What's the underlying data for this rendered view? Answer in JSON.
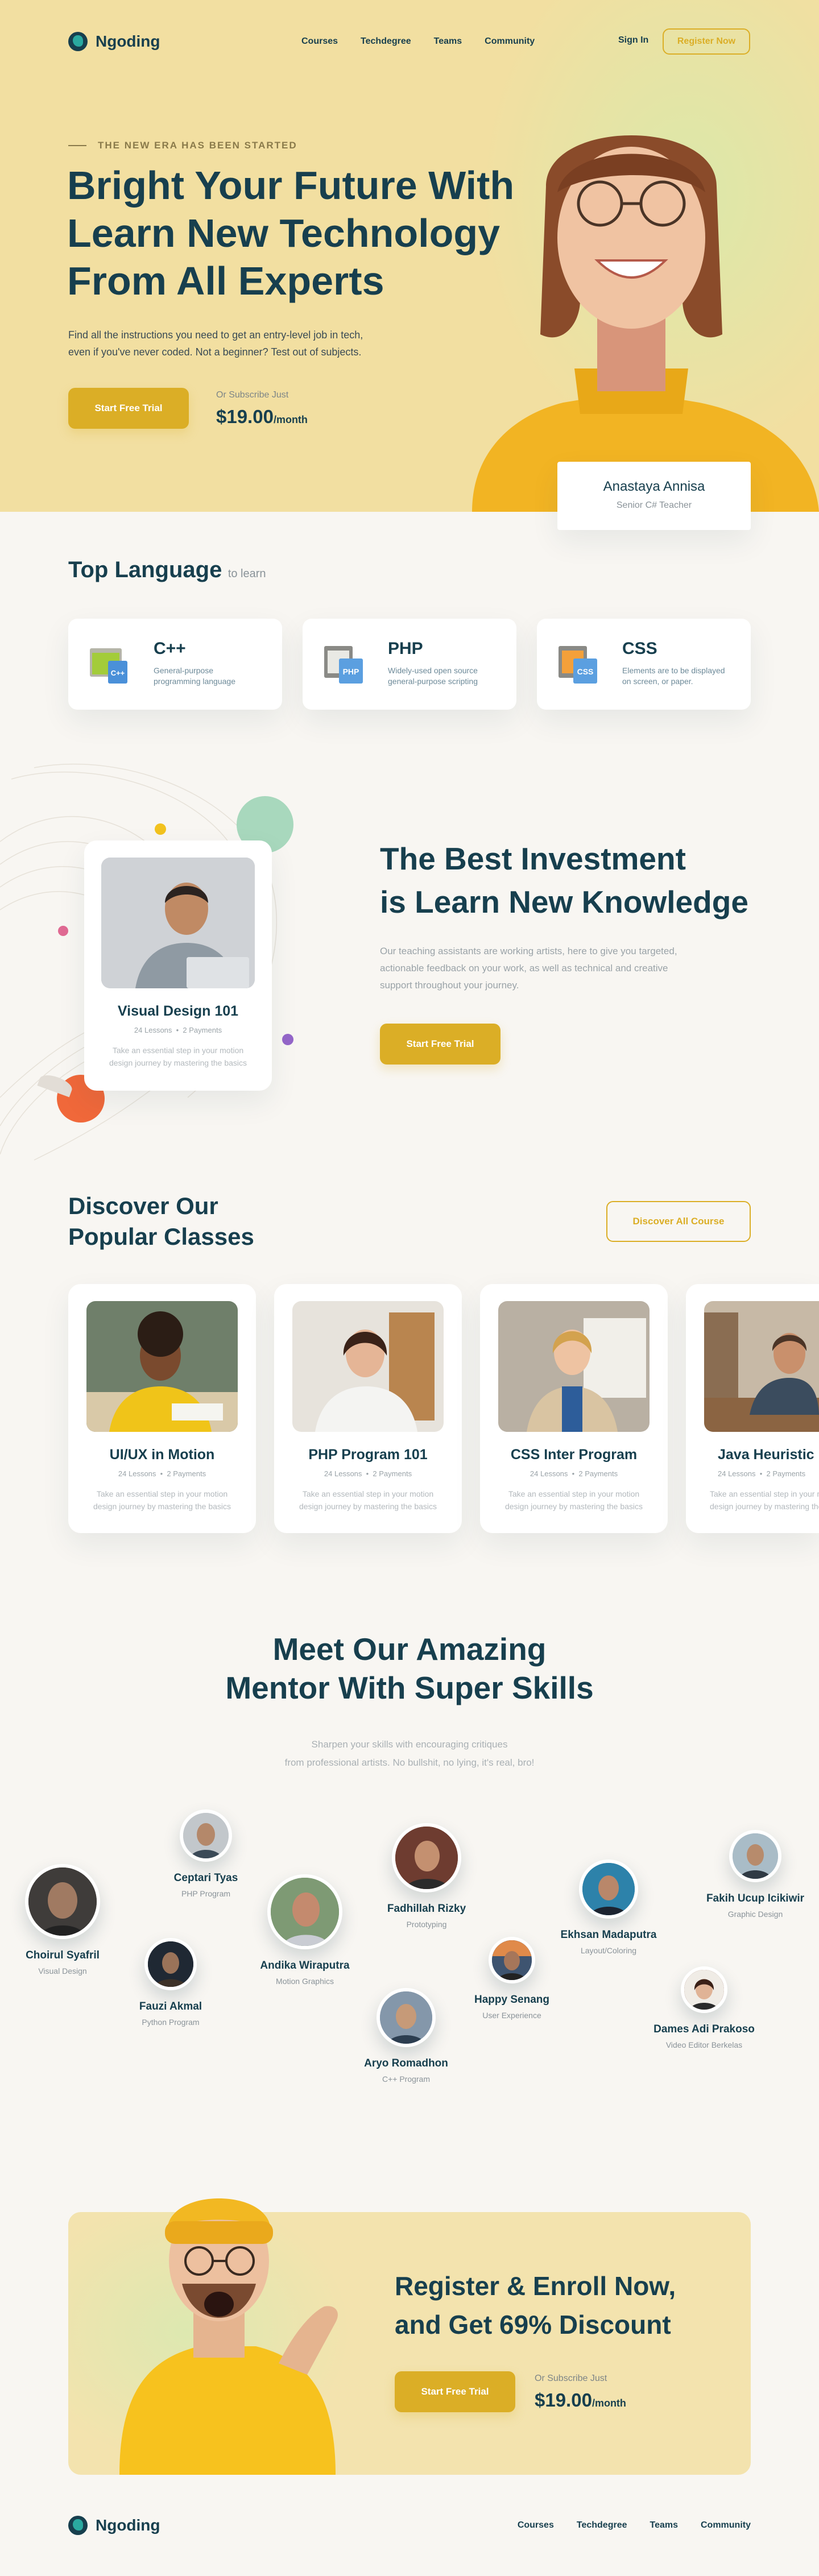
{
  "brand": {
    "name": "Ngoding"
  },
  "nav": {
    "items": [
      "Courses",
      "Techdegree",
      "Teams",
      "Community"
    ],
    "sign_in": "Sign In",
    "register": "Register Now"
  },
  "hero": {
    "eyebrow": "THE NEW ERA HAS BEEN STARTED",
    "title_lines": [
      "Bright Your Future With",
      "Learn New Technology",
      "From All Experts"
    ],
    "desc_lines": [
      "Find all the instructions you need to get an entry-level job in tech,",
      "even if you've never coded. Not a beginner? Test out of subjects."
    ],
    "cta": "Start Free Trial",
    "subscribe_label": "Or Subscribe Just",
    "price": "$19.00",
    "price_unit": "/month",
    "teacher_name": "Anastaya Annisa",
    "teacher_role": "Senior C# Teacher"
  },
  "languages": {
    "title": "Top Language",
    "title_suffix": "to learn",
    "items": [
      {
        "name": "C++",
        "desc_lines": [
          "General-purpose",
          "programming language"
        ],
        "icon": "cpp-file-icon"
      },
      {
        "name": "PHP",
        "desc_lines": [
          "Widely-used open source",
          "general-purpose scripting"
        ],
        "icon": "php-file-icon"
      },
      {
        "name": "CSS",
        "desc_lines": [
          "Elements are to be displayed",
          "on screen, or paper."
        ],
        "icon": "css-file-icon"
      }
    ]
  },
  "investment": {
    "card_title": "Visual Design 101",
    "card_meta": [
      "24 Lessons",
      "2 Payments"
    ],
    "card_desc_lines": [
      "Take an essential step in your motion",
      "design journey by mastering the basics"
    ],
    "title_lines": [
      "The Best Investment",
      "is Learn New Knowledge"
    ],
    "desc_lines": [
      "Our teaching assistants are working artists, here to give you targeted,",
      "actionable feedback on your work, as well as technical and creative",
      "support throughout your journey."
    ],
    "cta": "Start Free Trial"
  },
  "classes": {
    "title_lines": [
      "Discover Our",
      "Popular Classes"
    ],
    "cta": "Discover All Course",
    "items": [
      {
        "title": "UI/UX in Motion",
        "meta": [
          "24 Lessons",
          "2 Payments"
        ],
        "desc_lines": [
          "Take an essential step in your motion",
          "design journey by mastering the basics"
        ]
      },
      {
        "title": "PHP Program 101",
        "meta": [
          "24 Lessons",
          "2 Payments"
        ],
        "desc_lines": [
          "Take an essential step in your motion",
          "design journey by mastering the basics"
        ]
      },
      {
        "title": "CSS Inter Program",
        "meta": [
          "24 Lessons",
          "2 Payments"
        ],
        "desc_lines": [
          "Take an essential step in your motion",
          "design journey by mastering the basics"
        ]
      },
      {
        "title": "Java Heuristic U",
        "meta": [
          "24 Lessons",
          "2 Payments"
        ],
        "desc_lines": [
          "Take an essential step in your motion",
          "design journey by mastering the basics"
        ]
      }
    ]
  },
  "mentors": {
    "title_lines": [
      "Meet Our Amazing",
      "Mentor With Super Skills"
    ],
    "desc_lines": [
      "Sharpen your skills with encouraging critiques",
      "from professional artists. No bullshit, no lying, it's real, bro!"
    ],
    "items": [
      {
        "name": "Choirul Syafril",
        "role": "Visual Design"
      },
      {
        "name": "Ceptari Tyas",
        "role": "PHP Program"
      },
      {
        "name": "Fauzi Akmal",
        "role": "Python Program"
      },
      {
        "name": "Andika Wiraputra",
        "role": "Motion Graphics"
      },
      {
        "name": "Fadhillah Rizky",
        "role": "Prototyping"
      },
      {
        "name": "Aryo Romadhon",
        "role": "C++ Program"
      },
      {
        "name": "Happy Senang",
        "role": "User Experience"
      },
      {
        "name": "Ekhsan Madaputra",
        "role": "Layout/Coloring"
      },
      {
        "name": "Dames Adi Prakoso",
        "role": "Video Editor Berkelas"
      },
      {
        "name": "Fakih Ucup Icikiwir",
        "role": "Graphic Design"
      }
    ]
  },
  "register": {
    "title_lines": [
      "Register & Enroll Now,",
      "and Get 69% Discount"
    ],
    "cta": "Start Free Trial",
    "subscribe_label": "Or Subscribe Just",
    "price": "$19.00",
    "price_unit": "/month"
  },
  "footer": {
    "brand": "Ngoding",
    "nav": [
      "Courses",
      "Techdegree",
      "Teams",
      "Community"
    ]
  },
  "colors": {
    "accent": "#dbae26",
    "navy": "#173f4e",
    "hero_bg": "#f2dfa1",
    "muted": "#8a9399"
  }
}
